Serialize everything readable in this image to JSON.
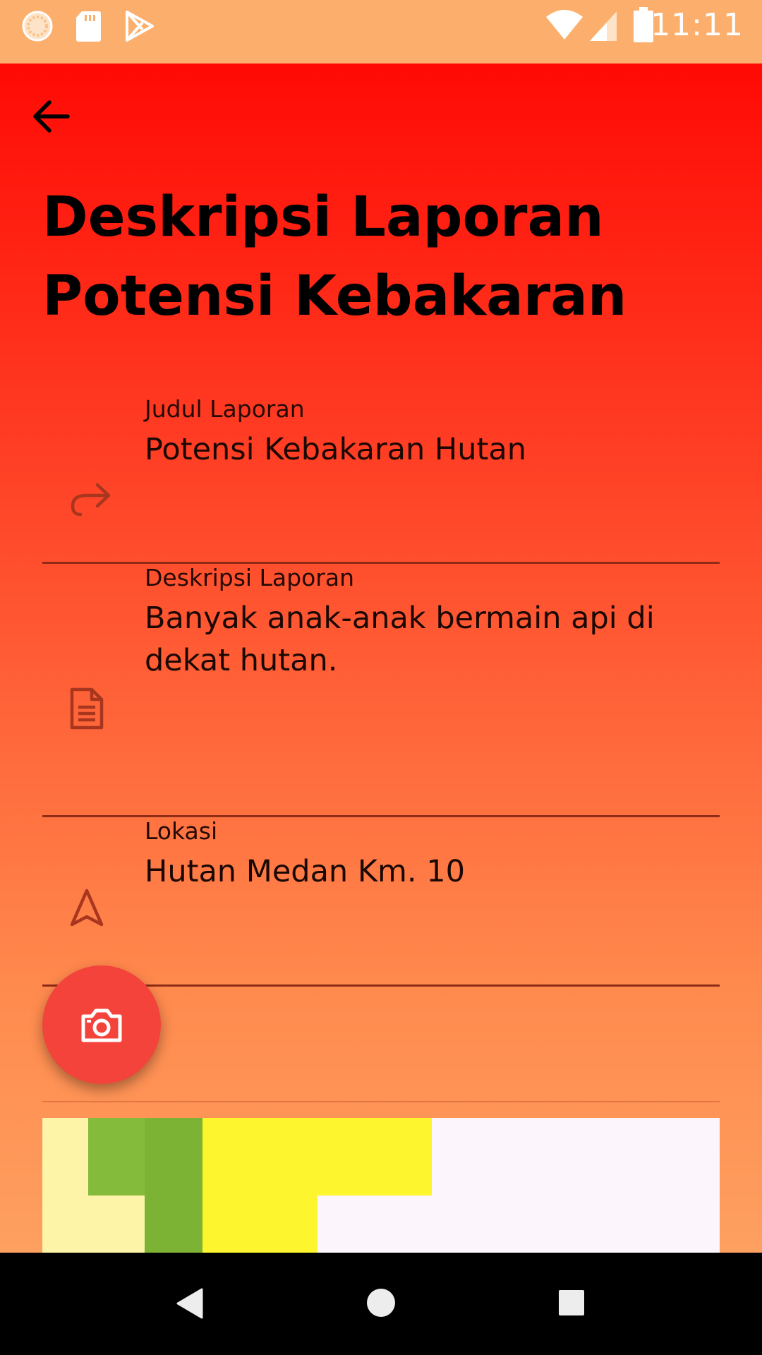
{
  "status_bar": {
    "time": "11:11",
    "left_icons": [
      "loading-indicator-icon",
      "sd-card-icon",
      "play-store-icon"
    ],
    "right_icons": [
      "wifi-icon",
      "cellular-signal-icon",
      "battery-icon"
    ]
  },
  "toolbar": {
    "back_icon": "arrow-left-icon"
  },
  "page": {
    "title_line1": "Deskripsi Laporan",
    "title_line2": "Potensi Kebakaran"
  },
  "fields": [
    {
      "icon": "redo-arrow-icon",
      "label": "Judul Laporan",
      "value": "Potensi Kebakaran Hutan"
    },
    {
      "icon": "document-icon",
      "label": "Deskripsi Laporan",
      "value": "Banyak anak-anak bermain api di dekat hutan."
    },
    {
      "icon": "navigation-icon",
      "label": "Lokasi",
      "value": "Hutan Medan Km. 10"
    }
  ],
  "camera_button": {
    "icon": "camera-icon"
  },
  "nav_bar": {
    "icons": [
      "back-triangle-icon",
      "home-circle-icon",
      "recents-square-icon"
    ]
  },
  "colors": {
    "status_bar": "#fcaf6c",
    "gradient_top": "#ff0a05",
    "gradient_bottom": "#fea060",
    "fab": "#f3433b",
    "field_divider": "#8e2c17",
    "map_background": "#fcf5fb",
    "map_yellow": "#fdf52d",
    "map_green": "#84bb3a",
    "map_pale_yellow": "#fef4a8"
  }
}
